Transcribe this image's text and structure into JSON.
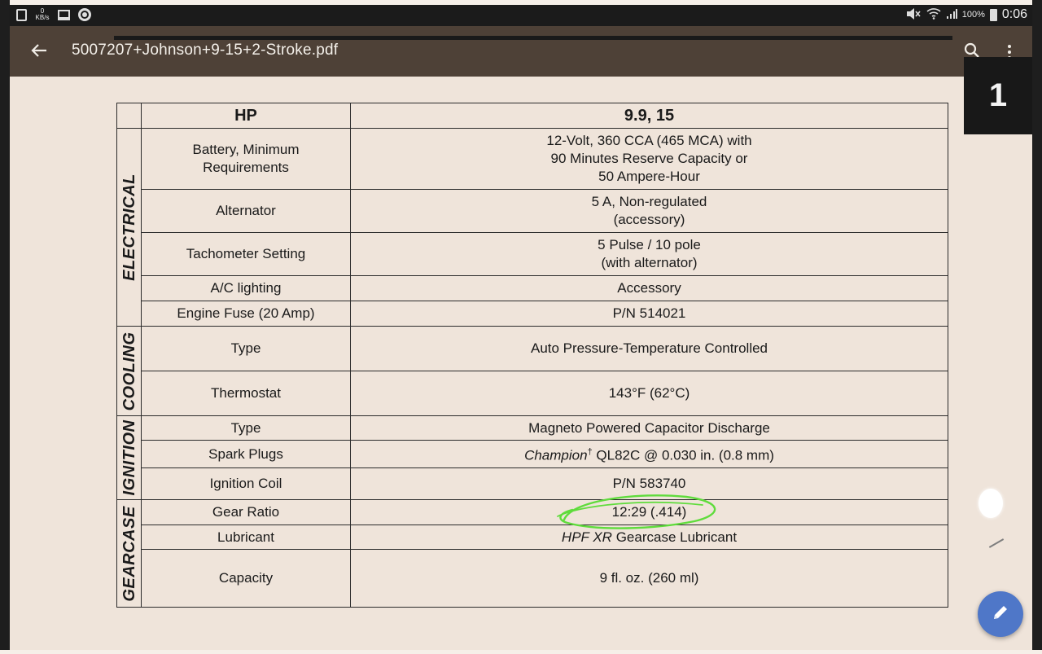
{
  "status_bar": {
    "data_rate_value": "0",
    "data_rate_unit": "KB/s",
    "battery": "100%",
    "time": "0:06"
  },
  "app_bar": {
    "title": "5007207+Johnson+9-15+2-Stroke.pdf",
    "icons": [
      "back-arrow-icon",
      "search-icon",
      "more-vert-icon"
    ]
  },
  "page_indicator": "1",
  "table": {
    "header": {
      "param": "HP",
      "value": "9.9, 15"
    },
    "sections": [
      {
        "category": "ELECTRICAL",
        "rows": [
          {
            "param": [
              "Battery, Minimum",
              "Requirements"
            ],
            "value": [
              "12-Volt, 360 CCA (465 MCA) with",
              "90 Minutes Reserve Capacity or",
              "50 Ampere-Hour"
            ]
          },
          {
            "param": [
              "Alternator"
            ],
            "value": [
              "5 A, Non-regulated",
              "(accessory)"
            ]
          },
          {
            "param": [
              "Tachometer Setting"
            ],
            "value": [
              "5 Pulse / 10 pole",
              "(with alternator)"
            ]
          },
          {
            "param": [
              "A/C lighting"
            ],
            "value": [
              "Accessory"
            ]
          },
          {
            "param": [
              "Engine Fuse (20 Amp)"
            ],
            "value": [
              "P/N 514021"
            ]
          }
        ]
      },
      {
        "category": "COOLING",
        "rows": [
          {
            "param": [
              "Type"
            ],
            "value": [
              "Auto Pressure-Temperature Controlled"
            ]
          },
          {
            "param": [
              "Thermostat"
            ],
            "value": [
              "143°F (62°C)"
            ]
          }
        ]
      },
      {
        "category": "IGNITION",
        "rows": [
          {
            "param": [
              "Type"
            ],
            "value": [
              "Magneto Powered Capacitor Discharge"
            ]
          },
          {
            "param": [
              "Spark Plugs"
            ],
            "value_italic": "Champion",
            "value_sup": "†",
            "value_rest": " QL82C @ 0.030 in. (0.8 mm)"
          },
          {
            "param": [
              "Ignition Coil"
            ],
            "value": [
              "P/N 583740"
            ]
          }
        ]
      },
      {
        "category": "GEARCASE",
        "rows": [
          {
            "param": [
              "Gear Ratio"
            ],
            "value": [
              "12:29 (.414)"
            ]
          },
          {
            "param": [
              "Lubricant"
            ],
            "value_italic": "HPF XR",
            "value_rest": " Gearcase Lubricant"
          },
          {
            "param": [
              "Capacity"
            ],
            "value": [
              "9 fl. oz. (260 ml)"
            ]
          }
        ]
      }
    ]
  },
  "annotation": {
    "color": "#5fdc3c"
  },
  "fab": {
    "icon": "edit-pencil-icon",
    "color": "#4f77c8"
  }
}
